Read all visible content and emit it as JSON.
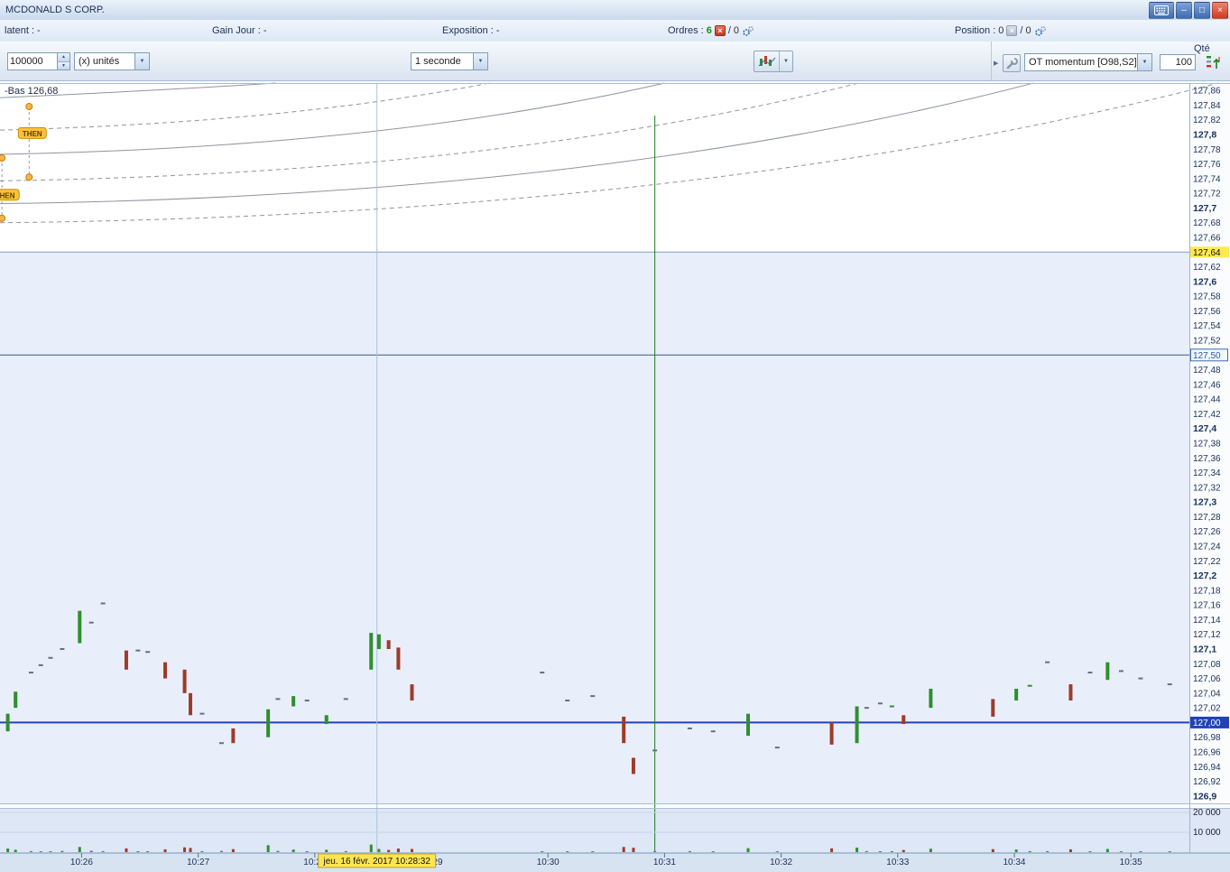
{
  "window": {
    "title": "MCDONALD S CORP."
  },
  "icons": {
    "minimize": "–",
    "maximize": "□",
    "close": "×",
    "x": "×",
    "dropdown": "▼",
    "spin_up": "▲",
    "spin_down": "▼",
    "panel_arrow": "▶"
  },
  "info_bar": {
    "latent": {
      "label": "latent :",
      "value": "-"
    },
    "gain_jour": {
      "label": "Gain Jour :",
      "value": "-"
    },
    "exposition": {
      "label": "Exposition :",
      "value": "-"
    },
    "ordres": {
      "label": "Ordres :",
      "count": "6",
      "slash": "/",
      "pending": "0"
    },
    "position": {
      "label": "Position :",
      "count": "0",
      "slash": "/",
      "pending": "0"
    }
  },
  "toolbar": {
    "quantity_value": "100000",
    "units_dropdown": "(x) unités",
    "timeframe_dropdown": "1 seconde",
    "indicator_dropdown": "OT momentum [O98,S2]",
    "qty_label": "Qté",
    "qty_value": "100"
  },
  "chart_data": {
    "type": "candlestick",
    "symbol": "MCDONALD S CORP.",
    "timeframe": "1 seconde",
    "session_low_label": "-Bas 126,68",
    "colors": {
      "up": "#2f8f2f",
      "down": "#9e3b2c",
      "neutral": "#66707e",
      "current_price_line": "#2143b8",
      "marker_line": "#1f7d1f",
      "cursor_line": "#a9c2de",
      "curve": "#8f949c",
      "zone_fill": "#e9effa",
      "volume_pane": "#dde7f6",
      "time_axis": "#d8e3f2"
    },
    "x_axis": {
      "start": "10:25:18",
      "end": "10:35:51",
      "minute_labels": [
        "10:26",
        "10:27",
        "10:28",
        "10:29",
        "10:30",
        "10:31",
        "10:32",
        "10:33",
        "10:34",
        "10:35"
      ]
    },
    "y_axis": {
      "max": 127.87,
      "min": 126.89,
      "tick_start": 127.86,
      "tick_step": 0.02,
      "tick_labels": [
        "127,86",
        "127,84",
        "127,82",
        "127,8",
        "127,78",
        "127,76",
        "127,74",
        "127,72",
        "127,7",
        "127,68",
        "127,66",
        "127,64",
        "127,62",
        "127,6",
        "127,58",
        "127,56",
        "127,54",
        "127,52",
        "127,5",
        "127,48",
        "127,46",
        "127,44",
        "127,42",
        "127,4",
        "127,38",
        "127,36",
        "127,34",
        "127,32",
        "127,3",
        "127,28",
        "127,26",
        "127,24",
        "127,22",
        "127,2",
        "127,18",
        "127,16",
        "127,14",
        "127,12",
        "127,1",
        "127,08",
        "127,06",
        "127,04",
        "127,02",
        "127",
        "126,98",
        "126,96",
        "126,94",
        "126,92",
        "126,9"
      ]
    },
    "volume_axis": {
      "labels": [
        "20 000",
        "10 000"
      ],
      "values": [
        20000,
        10000
      ]
    },
    "levels": [
      {
        "price": 127.64,
        "label": "127,64",
        "style": "yellow"
      },
      {
        "price": 127.5,
        "label": "127,50",
        "style": "boxed"
      },
      {
        "price": 127.0,
        "label": "127,00",
        "style": "blue"
      }
    ],
    "cursor": {
      "time": "10:28:32",
      "date_label": "jeu. 16 févr. 2017 10:28:32"
    },
    "marker_line_time": "10:30:55",
    "curves": [
      {
        "start_price": 127.85,
        "end_time": "10:27:40",
        "style": "solid"
      },
      {
        "start_price": 127.806,
        "end_time": "10:29:30",
        "style": "dashed"
      },
      {
        "start_price": 127.773,
        "end_time": "10:31:00",
        "style": "solid"
      },
      {
        "start_price": 127.737,
        "end_time": "10:32:40",
        "style": "dashed"
      },
      {
        "start_price": 127.706,
        "end_time": "10:34:10",
        "style": "solid"
      },
      {
        "start_price": 127.68,
        "end_time": "10:35:45",
        "style": "dashed"
      }
    ],
    "then_markers": [
      {
        "label": "THEN",
        "time": "10:25:33",
        "tag_price": 127.802,
        "dot_prices": [
          127.838,
          127.742
        ]
      },
      {
        "label": "THEN",
        "time": "10:25:19",
        "tag_price": 127.718,
        "dot_prices": [
          127.768,
          127.686
        ]
      }
    ],
    "candles": [
      [
        "10:25:22",
        127.012,
        126.988,
        "g",
        1800
      ],
      [
        "10:25:26",
        127.042,
        127.02,
        "g",
        1200
      ],
      [
        "10:25:34",
        127.068,
        127.068,
        "n",
        500
      ],
      [
        "10:25:39",
        127.078,
        127.078,
        "n",
        400
      ],
      [
        "10:25:44",
        127.088,
        127.088,
        "n",
        400
      ],
      [
        "10:25:50",
        127.1,
        127.1,
        "n",
        600
      ],
      [
        "10:25:59",
        127.152,
        127.108,
        "g",
        2600
      ],
      [
        "10:26:05",
        127.136,
        127.136,
        "n",
        700
      ],
      [
        "10:26:11",
        127.162,
        127.162,
        "n",
        500
      ],
      [
        "10:26:23",
        127.098,
        127.072,
        "r",
        1900
      ],
      [
        "10:26:29",
        127.098,
        127.098,
        "n",
        400
      ],
      [
        "10:26:34",
        127.096,
        127.096,
        "n",
        400
      ],
      [
        "10:26:43",
        127.082,
        127.06,
        "r",
        1400
      ],
      [
        "10:26:53",
        127.072,
        127.04,
        "r",
        2400
      ],
      [
        "10:26:56",
        127.04,
        127.01,
        "r",
        2100
      ],
      [
        "10:27:02",
        127.012,
        127.012,
        "n",
        500
      ],
      [
        "10:27:12",
        126.972,
        126.972,
        "n",
        600
      ],
      [
        "10:27:18",
        126.992,
        126.972,
        "r",
        1500
      ],
      [
        "10:27:36",
        127.018,
        126.98,
        "g",
        3500
      ],
      [
        "10:27:41",
        127.032,
        127.032,
        "n",
        600
      ],
      [
        "10:27:49",
        127.036,
        127.022,
        "g",
        1300
      ],
      [
        "10:27:56",
        127.03,
        127.03,
        "n",
        400
      ],
      [
        "10:28:06",
        127.01,
        126.998,
        "g",
        1200
      ],
      [
        "10:28:16",
        127.032,
        127.032,
        "n",
        500
      ],
      [
        "10:28:29",
        127.122,
        127.072,
        "g",
        3800
      ],
      [
        "10:28:33",
        127.12,
        127.1,
        "g",
        1600
      ],
      [
        "10:28:38",
        127.112,
        127.1,
        "r",
        1100
      ],
      [
        "10:28:43",
        127.102,
        127.072,
        "r",
        1800
      ],
      [
        "10:28:50",
        127.052,
        127.03,
        "r",
        1600
      ],
      [
        "10:29:57",
        127.068,
        127.068,
        "n",
        400
      ],
      [
        "10:30:10",
        127.03,
        127.03,
        "n",
        400
      ],
      [
        "10:30:23",
        127.036,
        127.036,
        "n",
        400
      ],
      [
        "10:30:39",
        127.008,
        126.972,
        "r",
        2600
      ],
      [
        "10:30:44",
        126.952,
        126.93,
        "r",
        2200
      ],
      [
        "10:30:55",
        126.962,
        126.962,
        "n",
        500
      ],
      [
        "10:31:13",
        126.992,
        126.992,
        "n",
        500
      ],
      [
        "10:31:25",
        126.988,
        126.988,
        "n",
        400
      ],
      [
        "10:31:43",
        127.012,
        126.982,
        "g",
        2000
      ],
      [
        "10:31:58",
        126.966,
        126.966,
        "n",
        400
      ],
      [
        "10:32:26",
        127.0,
        126.97,
        "r",
        1900
      ],
      [
        "10:32:39",
        127.022,
        126.972,
        "g",
        2300
      ],
      [
        "10:32:44",
        127.02,
        127.02,
        "n",
        500
      ],
      [
        "10:32:51",
        127.026,
        127.026,
        "n",
        400
      ],
      [
        "10:32:57",
        127.022,
        127.022,
        "g",
        400
      ],
      [
        "10:33:03",
        127.01,
        126.998,
        "r",
        1100
      ],
      [
        "10:33:17",
        127.046,
        127.02,
        "g",
        1700
      ],
      [
        "10:33:49",
        127.032,
        127.008,
        "r",
        1500
      ],
      [
        "10:34:01",
        127.046,
        127.03,
        "g",
        1300
      ],
      [
        "10:34:08",
        127.05,
        127.05,
        "g",
        500
      ],
      [
        "10:34:17",
        127.082,
        127.082,
        "n",
        500
      ],
      [
        "10:34:29",
        127.052,
        127.03,
        "r",
        1400
      ],
      [
        "10:34:39",
        127.068,
        127.068,
        "n",
        400
      ],
      [
        "10:34:48",
        127.082,
        127.058,
        "g",
        1600
      ],
      [
        "10:34:55",
        127.07,
        127.07,
        "n",
        400
      ],
      [
        "10:35:05",
        127.06,
        127.06,
        "n",
        400
      ],
      [
        "10:35:20",
        127.052,
        127.052,
        "n",
        400
      ]
    ]
  }
}
